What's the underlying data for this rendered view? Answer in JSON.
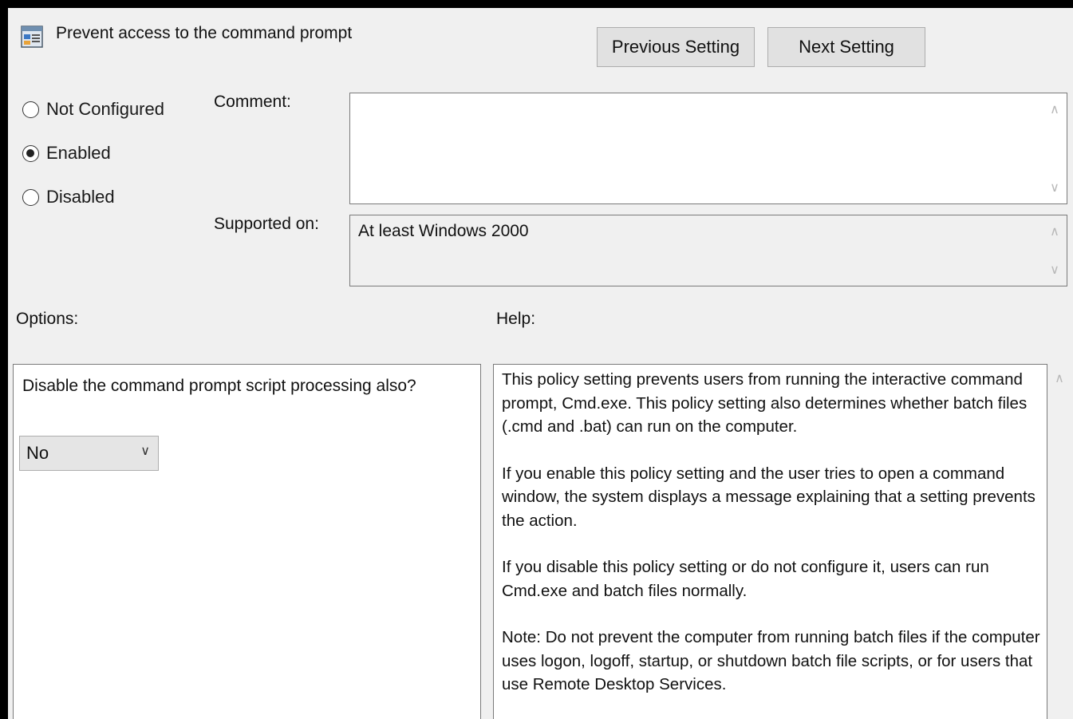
{
  "title": "Prevent access to the command prompt",
  "buttons": {
    "previous": "Previous Setting",
    "next": "Next Setting"
  },
  "state": {
    "options": [
      {
        "label": "Not Configured",
        "checked": false
      },
      {
        "label": "Enabled",
        "checked": true
      },
      {
        "label": "Disabled",
        "checked": false
      }
    ]
  },
  "comment": {
    "label": "Comment:",
    "value": ""
  },
  "supported": {
    "label": "Supported on:",
    "value": "At least Windows 2000"
  },
  "options_section": {
    "label": "Options:",
    "question": "Disable the command prompt script processing also?",
    "select_value": "No"
  },
  "help_section": {
    "label": "Help:",
    "paragraphs": [
      "This policy setting prevents users from running the interactive command prompt, Cmd.exe.  This policy setting also determines whether batch files (.cmd and .bat) can run on the computer.",
      "If you enable this policy setting and the user tries to open a command window, the system displays a message explaining that a setting prevents the action.",
      "If you disable this policy setting or do not configure it, users can run Cmd.exe and batch files normally.",
      "Note: Do not prevent the computer from running batch files if the computer uses logon, logoff, startup, or shutdown batch file scripts, or for users that use Remote Desktop Services."
    ]
  },
  "icons": {
    "title": "policy-setting-icon",
    "scroll_up": "chevron-up-icon",
    "scroll_down": "chevron-down-icon",
    "select": "chevron-down-icon"
  }
}
